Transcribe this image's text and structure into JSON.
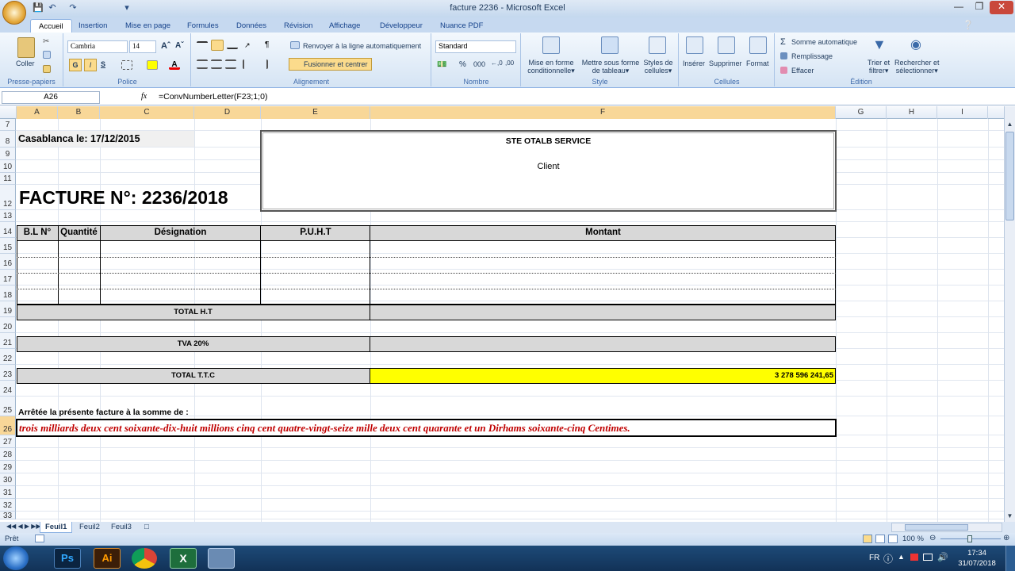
{
  "window": {
    "title": "facture 2236 - Microsoft Excel"
  },
  "tabs": [
    "Accueil",
    "Insertion",
    "Mise en page",
    "Formules",
    "Données",
    "Révision",
    "Affichage",
    "Développeur",
    "Nuance PDF"
  ],
  "ribbon": {
    "coller": "Coller",
    "presse": "Presse-papiers",
    "font_name": "Cambria",
    "font_size": "14",
    "police": "Police",
    "wrap": "Renvoyer à la ligne automatiquement",
    "merge": "Fusionner et centrer",
    "alignement": "Alignement",
    "number_format": "Standard",
    "nombre": "Nombre",
    "cond1": "Mise en forme",
    "cond2": "conditionnelle",
    "table1": "Mettre sous forme",
    "table2": "de tableau",
    "styles1": "Styles de",
    "styles2": "cellules",
    "style": "Style",
    "inserer": "Insérer",
    "supprimer": "Supprimer",
    "format": "Format",
    "cellules": "Cellules",
    "autosum": "Somme automatique",
    "remplissage": "Remplissage",
    "effacer": "Effacer",
    "trier1": "Trier et",
    "trier2": "filtrer",
    "rech1": "Rechercher et",
    "rech2": "sélectionner",
    "edition": "Édition",
    "bold": "G",
    "italic": "I",
    "underline": "S"
  },
  "formula_bar": {
    "name_box": "A26",
    "fx": "fx",
    "formula": "=ConvNumberLetter(F23;1;0)"
  },
  "columns": [
    "A",
    "B",
    "C",
    "D",
    "E",
    "F",
    "G",
    "H",
    "I"
  ],
  "rows": [
    "7",
    "8",
    "9",
    "10",
    "11",
    "12",
    "13",
    "14",
    "15",
    "16",
    "17",
    "18",
    "19",
    "20",
    "21",
    "22",
    "23",
    "24",
    "25",
    "26",
    "27",
    "28",
    "29",
    "30",
    "31",
    "32",
    "33"
  ],
  "sheet": {
    "date": "Casablanca le: 17/12/2015",
    "invoice": "FACTURE N°: 2236/2018",
    "company": "STE OTALB SERVICE",
    "client": "Client",
    "h_bl": "B.L N°",
    "h_qty": "Quantité",
    "h_desig": "Désignation",
    "h_puht": "P.U.H.T",
    "h_montant": "Montant",
    "total_ht": "TOTAL H.T",
    "tva": "TVA 20%",
    "total_ttc": "TOTAL T.T.C",
    "total_value": "3 278 596 241,65",
    "arrete": "Arrêtée la présente facture à la somme de :",
    "words": "trois milliards deux cent soixante-dix-huit millions cinq cent quatre-vingt-seize mille deux cent quarante et un Dirhams soixante-cinq Centimes."
  },
  "sheet_tabs": [
    "Feuil1",
    "Feuil2",
    "Feuil3"
  ],
  "status": {
    "ready": "Prêt",
    "zoom": "100 %"
  },
  "taskbar": {
    "lang": "FR",
    "time": "17:34",
    "date": "31/07/2018",
    "ps": "Ps",
    "ai": "Ai"
  },
  "colors": {
    "accent_yellow": "#ffff00",
    "words_red": "#c00000"
  }
}
